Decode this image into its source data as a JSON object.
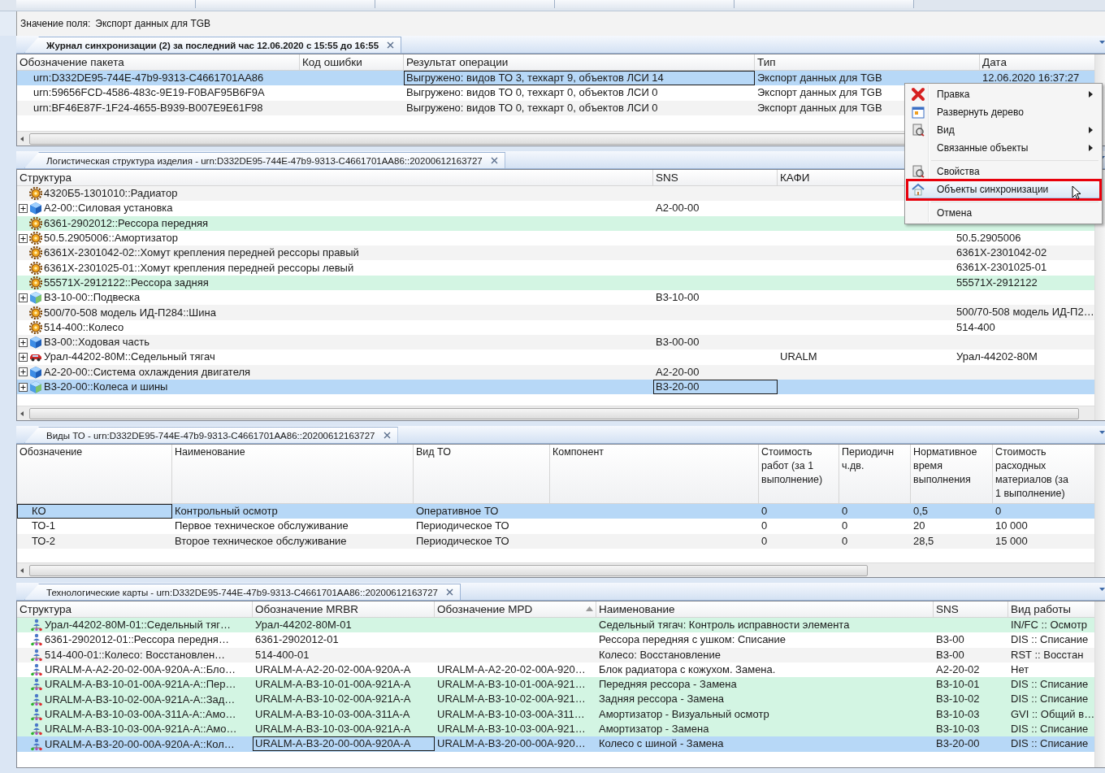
{
  "field_bar": {
    "label": "Значение поля:",
    "value": "Экспорт данных для TGB"
  },
  "panels": [
    {
      "kind": "table",
      "tab": {
        "title": "Журнал синхронизации (2) за последний час 12.06.2020 с 15:55 до 16:55",
        "active": true
      },
      "columns": [
        {
          "label": "Обозначение пакета"
        },
        {
          "label": "Код ошибки"
        },
        {
          "label": "Результат операции"
        },
        {
          "label": "Тип"
        },
        {
          "label": "Дата"
        }
      ],
      "rows": [
        {
          "selected": true,
          "cells": [
            "urn:D332DE95-744E-47b9-9313-C4661701AA86",
            null,
            {
              "text": "Выгружено: видов ТО 3, техкарт 9, объектов ЛСИ 14",
              "focused": true
            },
            "Экспорт данных для TGB",
            "12.06.2020 16:37:27"
          ]
        },
        {
          "selected": false,
          "cells": [
            "urn:59656FCD-4586-483c-9E19-F0BAF95B6F9A",
            null,
            "Выгружено: видов ТО 0, техкарт 0, объектов ЛСИ 0",
            "Экспорт данных для TGB",
            null
          ]
        },
        {
          "selected": false,
          "cells": [
            "urn:BF46E87F-1F24-4655-B939-B007E9E61F98",
            null,
            "Выгружено: видов ТО 0, техкарт 0, объектов ЛСИ 0",
            "Экспорт данных для TGB",
            null
          ]
        }
      ]
    },
    {
      "kind": "tree",
      "tab": {
        "title": "Логистическая структура изделия - urn:D332DE95-744E-47b9-9313-C4661701AA86::20200612163727",
        "active": false
      },
      "columns": [
        {
          "label": "Структура"
        },
        {
          "label": "SNS"
        },
        {
          "label": "КАФИ"
        }
      ],
      "rows": [
        {
          "kind": "part",
          "selected": false,
          "cells": [
            "4320Б5-1301010::Радиатор",
            null,
            null,
            null
          ]
        },
        {
          "kind": "assembly",
          "expanded": false,
          "selected": false,
          "cells": [
            "A2-00::Силовая установка",
            "A2-00-00",
            null,
            null
          ]
        },
        {
          "kind": "part",
          "selected": false,
          "color": "#d3f5e3",
          "cells": [
            "6361-2902012::Рессора передняя",
            null,
            null,
            null
          ]
        },
        {
          "kind": "part",
          "expanded": false,
          "selected": false,
          "cells": [
            "50.5.2905006::Амортизатор",
            null,
            null,
            "50.5.2905006"
          ]
        },
        {
          "kind": "part",
          "selected": false,
          "cells": [
            "6361X-2301042-02::Хомут крепления передней рессоры правый",
            null,
            null,
            "6361X-2301042-02"
          ]
        },
        {
          "kind": "part",
          "selected": false,
          "cells": [
            "6361X-2301025-01::Хомут крепления передней рессоры левый",
            null,
            null,
            "6361X-2301025-01"
          ]
        },
        {
          "kind": "part",
          "selected": false,
          "color": "#d3f5e3",
          "cells": [
            "55571X-2912122::Рессора задняя",
            null,
            null,
            "55571X-2912122"
          ]
        },
        {
          "kind": "assembly-checked",
          "expanded": false,
          "selected": false,
          "cells": [
            "B3-10-00::Подвеска",
            "B3-10-00",
            null,
            null
          ]
        },
        {
          "kind": "part",
          "selected": false,
          "cells": [
            "500/70-508 модель ИД-П284::Шина",
            null,
            null,
            "500/70-508 модель ИД-П2…"
          ]
        },
        {
          "kind": "part",
          "selected": false,
          "cells": [
            "514-400::Колесо",
            null,
            null,
            "514-400"
          ]
        },
        {
          "kind": "assembly",
          "expanded": false,
          "selected": false,
          "cells": [
            "B3-00::Ходовая часть",
            "B3-00-00",
            null,
            null
          ]
        },
        {
          "kind": "vehicle",
          "expanded": false,
          "selected": false,
          "cells": [
            "Урал-44202-80М::Седельный тягач",
            null,
            "URALM",
            "Урал-44202-80М"
          ]
        },
        {
          "kind": "assembly",
          "expanded": false,
          "selected": false,
          "cells": [
            "A2-20-00::Система охлаждения двигателя",
            "A2-20-00",
            null,
            null
          ]
        },
        {
          "kind": "assembly-checked",
          "expanded": false,
          "selected": true,
          "cells": [
            "B3-20-00::Колеса и шины",
            {
              "text": "B3-20-00",
              "focused": true
            },
            null,
            null
          ]
        }
      ]
    },
    {
      "kind": "table",
      "tab": {
        "title": "Виды ТО - urn:D332DE95-744E-47b9-9313-C4661701AA86::20200612163727",
        "active": false
      },
      "columns": [
        {
          "label": "Обозначение"
        },
        {
          "label": "Наименование"
        },
        {
          "label": "Вид ТО"
        },
        {
          "label": "Компонент"
        },
        {
          "label": "Стоимость\nработ (за 1\nвыполнение)"
        },
        {
          "label": "Периодичн\nч.дв."
        },
        {
          "label": "Нормативное\nвремя\nвыполнения"
        },
        {
          "label": "Стоимость\nрасходных\nматериалов (за\n1 выполнение)"
        }
      ],
      "rows": [
        {
          "selected": true,
          "cells": [
            {
              "text": "КО",
              "focused": true
            },
            "Контрольный осмотр",
            "Оперативное ТО",
            null,
            "0",
            "0",
            "0,5",
            "0"
          ]
        },
        {
          "selected": false,
          "cells": [
            "ТО-1",
            "Первое техническое обслуживание",
            "Периодическое ТО",
            null,
            "0",
            "0",
            "20",
            "10 000"
          ]
        },
        {
          "selected": false,
          "cells": [
            "ТО-2",
            "Второе техническое обслуживание",
            "Периодическое ТО",
            null,
            "0",
            "0",
            "28,5",
            "15 000"
          ]
        }
      ]
    },
    {
      "kind": "icon-table",
      "tab": {
        "title": "Технологические карты - urn:D332DE95-744E-47b9-9313-C4661701AA86::20200612163727",
        "active": false
      },
      "columns": [
        {
          "label": "Структура",
          "sorted": false
        },
        {
          "label": "Обозначение MRBR",
          "sorted": false
        },
        {
          "label": "Обозначение MPD",
          "sorted": true
        },
        {
          "label": "Наименование",
          "sorted": false
        },
        {
          "label": "SNS",
          "sorted": false
        },
        {
          "label": "Вид работы",
          "sorted": false
        }
      ],
      "rows": [
        {
          "selected": false,
          "color": "#d3f5e3",
          "cells": [
            "Урал-44202-80М-01::Седельный тяг…",
            "Урал-44202-80М-01",
            null,
            "Седельный тягач: Контроль исправности элемента",
            null,
            "IN/FC :: Осмотр"
          ]
        },
        {
          "selected": false,
          "cells": [
            "6361-2902012-01::Рессора передня…",
            "6361-2902012-01",
            null,
            "Рессора передняя с ушком: Списание",
            "B3-00",
            "DIS :: Списание"
          ]
        },
        {
          "selected": false,
          "cells": [
            "514-400-01::Колесо: Восстановлен…",
            "514-400-01",
            null,
            "Колесо: Восстановление",
            "B3-00",
            "RST :: Восстан"
          ]
        },
        {
          "selected": false,
          "cells": [
            "URALM-A-A2-20-02-00A-920A-A::Бло…",
            "URALM-A-A2-20-02-00A-920A-A",
            "URALM-A-A2-20-02-00A-920…",
            "Блок радиатора с кожухом. Замена.",
            "A2-20-02",
            "Нет"
          ]
        },
        {
          "selected": false,
          "color": "#d3f5e3",
          "cells": [
            "URALM-A-B3-10-01-00A-921A-A::Пер…",
            "URALM-A-B3-10-01-00A-921A-A",
            "URALM-A-B3-10-01-00A-921…",
            "Передняя рессора - Замена",
            "B3-10-01",
            "DIS :: Списание"
          ]
        },
        {
          "selected": false,
          "color": "#d3f5e3",
          "cells": [
            "URALM-A-B3-10-02-00A-921A-A::Зад…",
            "URALM-A-B3-10-02-00A-921A-A",
            "URALM-A-B3-10-02-00A-921…",
            "Задняя рессора - Замена",
            "B3-10-02",
            "DIS :: Списание"
          ]
        },
        {
          "selected": false,
          "color": "#d3f5e3",
          "cells": [
            "URALM-A-B3-10-03-00A-311A-A::Амо…",
            "URALM-A-B3-10-03-00A-311A-A",
            "URALM-A-B3-10-03-00A-311…",
            "Амортизатор - Визуальный осмотр",
            "B3-10-03",
            "GVI :: Общий в…"
          ]
        },
        {
          "selected": false,
          "color": "#d3f5e3",
          "cells": [
            "URALM-A-B3-10-03-00A-921A-A::Амо…",
            "URALM-A-B3-10-03-00A-921A-A",
            "URALM-A-B3-10-03-00A-921…",
            "Амортизатор - Замена",
            "B3-10-03",
            "DIS :: Списание"
          ]
        },
        {
          "selected": true,
          "cells": [
            "URALM-A-B3-20-00-00A-920A-A::Кол…",
            {
              "text": "URALM-A-B3-20-00-00A-920A-A",
              "focused": true
            },
            "URALM-A-B3-20-00-00A-920…",
            "Колесо с шиной - Замена",
            "B3-20-00",
            "DIS :: Списание"
          ]
        }
      ]
    }
  ],
  "context_menu": {
    "items": [
      {
        "kind": "item",
        "label": "Правка",
        "submenu": true,
        "selected": false
      },
      {
        "kind": "item",
        "label": "Развернуть дерево",
        "submenu": false,
        "selected": false
      },
      {
        "kind": "item",
        "label": "Вид",
        "submenu": true,
        "selected": false
      },
      {
        "kind": "item",
        "label": "Связанные объекты",
        "submenu": true,
        "selected": false
      },
      {
        "kind": "separator"
      },
      {
        "kind": "item",
        "label": "Свойства",
        "submenu": false,
        "selected": false
      },
      {
        "kind": "item",
        "label": "Объекты синхронизации",
        "submenu": false,
        "selected": true
      },
      {
        "kind": "separator"
      },
      {
        "kind": "item",
        "label": "Отмена",
        "submenu": false,
        "selected": false
      }
    ]
  }
}
